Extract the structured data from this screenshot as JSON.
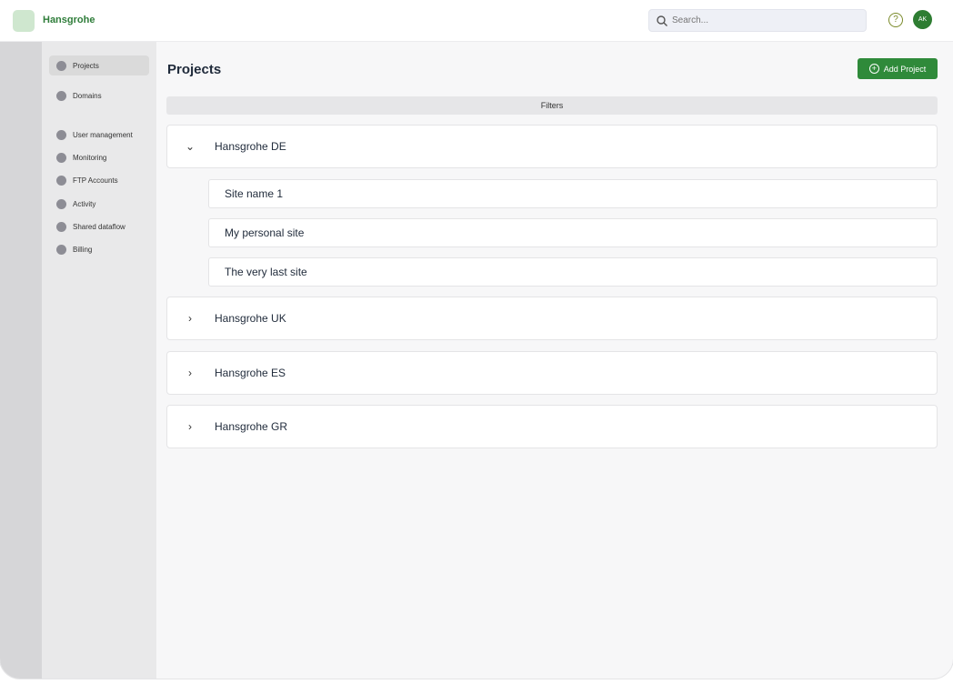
{
  "app": {
    "name": "Hansgrohe"
  },
  "search": {
    "placeholder": "Search..."
  },
  "header": {
    "help_symbol": "?",
    "avatar_initials": "AK"
  },
  "sidebar": {
    "items": [
      {
        "label": "Projects"
      },
      {
        "label": "Domains"
      },
      {
        "label": "User management"
      },
      {
        "label": "Monitoring"
      },
      {
        "label": "FTP Accounts"
      },
      {
        "label": "Activity"
      },
      {
        "label": "Shared dataflow"
      },
      {
        "label": "Billing"
      }
    ]
  },
  "main": {
    "title": "Projects",
    "add_button": "Add Project",
    "filters_label": "Filters",
    "groups": [
      {
        "name": "Hansgrohe DE",
        "chevron": "⌄",
        "sites": [
          "Site name 1",
          "My personal site",
          "The very last site"
        ]
      },
      {
        "name": "Hansgrohe UK",
        "chevron": "›"
      },
      {
        "name": "Hansgrohe ES",
        "chevron": "›"
      },
      {
        "name": "Hansgrohe GR",
        "chevron": "›"
      }
    ]
  },
  "colors": {
    "accent": "#2f8a3a",
    "sidebar_bg": "#e9e9ea",
    "rail_bg": "#d6d6d8"
  }
}
